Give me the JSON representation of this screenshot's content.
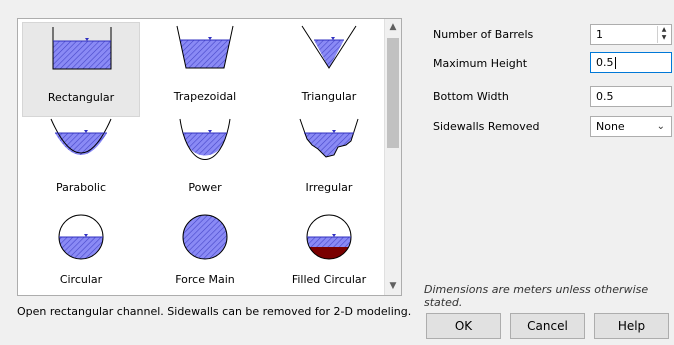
{
  "gallery": {
    "items": [
      {
        "label": "Rectangular",
        "icon": "rectangular-channel-icon",
        "selected": true
      },
      {
        "label": "Trapezoidal",
        "icon": "trapezoidal-channel-icon"
      },
      {
        "label": "Triangular",
        "icon": "triangular-channel-icon"
      },
      {
        "label": "Parabolic",
        "icon": "parabolic-channel-icon"
      },
      {
        "label": "Power",
        "icon": "power-channel-icon"
      },
      {
        "label": "Irregular",
        "icon": "irregular-channel-icon"
      },
      {
        "label": "Circular",
        "icon": "circular-conduit-icon"
      },
      {
        "label": "Force Main",
        "icon": "force-main-icon"
      },
      {
        "label": "Filled Circular",
        "icon": "filled-circular-conduit-icon"
      }
    ]
  },
  "fields": {
    "barrels_label": "Number of Barrels",
    "barrels_value": "1",
    "max_height_label": "Maximum Height",
    "max_height_value": "0.5",
    "bottom_width_label": "Bottom Width",
    "bottom_width_value": "0.5",
    "sidewalls_label": "Sidewalls Removed",
    "sidewalls_value": "None"
  },
  "units_note": "Dimensions are meters unless otherwise stated.",
  "description": "Open rectangular channel. Sidewalls can be removed for 2-D modeling.",
  "buttons": {
    "ok": "OK",
    "cancel": "Cancel",
    "help": "Help"
  },
  "colors": {
    "water": "#7b7bf0",
    "hatch": "#4646c8",
    "sediment": "#7a0000",
    "focus": "#0078d7"
  }
}
